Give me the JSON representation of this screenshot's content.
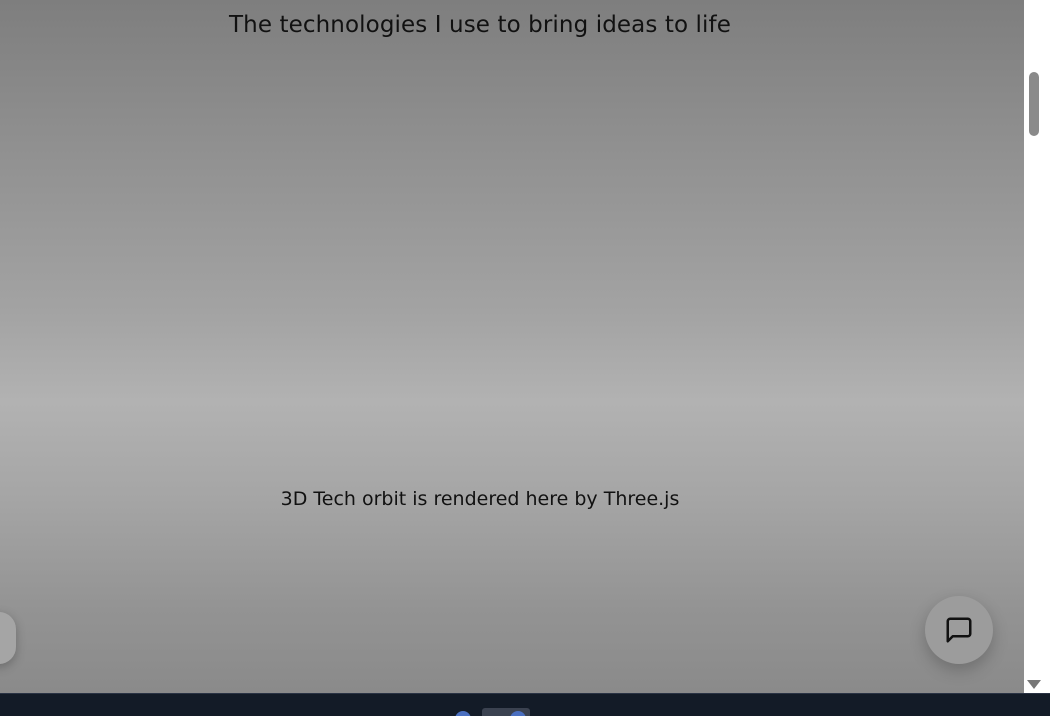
{
  "page": {
    "subtitle": "The technologies I use to bring ideas to life",
    "canvas_fallback": "3D Tech orbit is rendered here by Three.js"
  },
  "chat_button": {
    "icon": "message-square-icon"
  },
  "colors": {
    "background_top": "#7e7e7e",
    "background_mid": "#b2b2b2",
    "text": "#111111",
    "taskbar": "#131b27"
  }
}
